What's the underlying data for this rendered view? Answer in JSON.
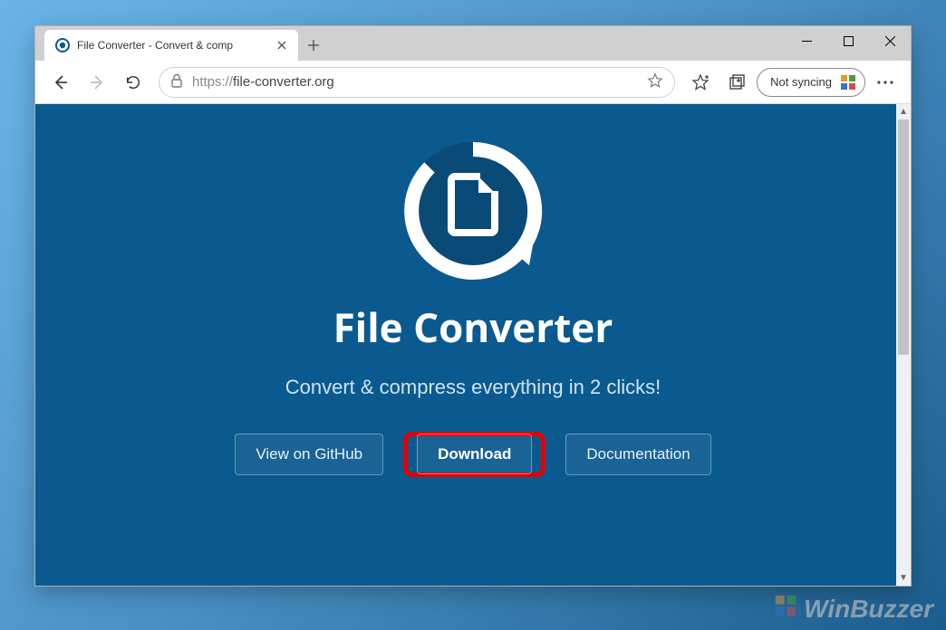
{
  "browser": {
    "tab_title": "File Converter - Convert & comp",
    "address": {
      "scheme": "https://",
      "host": "file-converter.org"
    },
    "sync_label": "Not syncing"
  },
  "page": {
    "title": "File Converter",
    "subtitle": "Convert & compress everything in 2 clicks!",
    "actions": {
      "github": "View on GitHub",
      "download": "Download",
      "documentation": "Documentation"
    }
  },
  "watermark": "WinBuzzer"
}
